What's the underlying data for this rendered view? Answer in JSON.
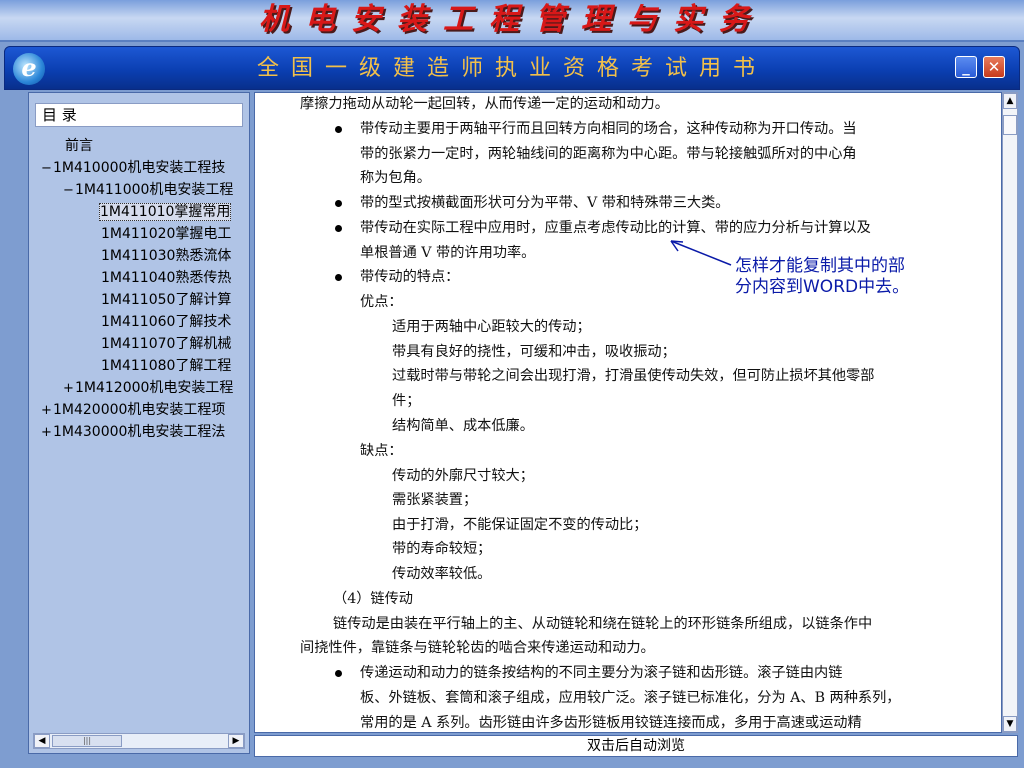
{
  "banner": {
    "title": "机电安装工程管理与实务"
  },
  "titlebar": {
    "subtitle": "全国一级建造师执业资格考试用书",
    "min_glyph": "_",
    "close_glyph": "✕"
  },
  "toc": {
    "header": "目 录",
    "items": [
      {
        "toggle": "",
        "label": "前言"
      },
      {
        "toggle": "−",
        "label": "1M410000机电安装工程技"
      },
      {
        "toggle": "−",
        "label": "1M411000机电安装工程"
      },
      {
        "toggle": "",
        "label": "1M411010掌握常用"
      },
      {
        "toggle": "",
        "label": "1M411020掌握电工"
      },
      {
        "toggle": "",
        "label": "1M411030熟悉流体"
      },
      {
        "toggle": "",
        "label": "1M411040熟悉传热"
      },
      {
        "toggle": "",
        "label": "1M411050了解计算"
      },
      {
        "toggle": "",
        "label": "1M411060了解技术"
      },
      {
        "toggle": "",
        "label": "1M411070了解机械"
      },
      {
        "toggle": "",
        "label": "1M411080了解工程"
      },
      {
        "toggle": "+",
        "label": "1M412000机电安装工程"
      },
      {
        "toggle": "+",
        "label": "1M420000机电安装工程项"
      },
      {
        "toggle": "+",
        "label": "1M430000机电安装工程法"
      }
    ]
  },
  "content": {
    "lines": [
      "摩擦力拖动从动轮一起回转，从而传递一定的运动和动力。",
      "带传动主要用于两轴平行而且回转方向相同的场合，这种传动称为开口传动。当",
      "带的张紧力一定时，两轮轴线间的距离称为中心距。带与轮接触弧所对的中心角",
      "称为包角。",
      "带的型式按横截面形状可分为平带、V 带和特殊带三大类。",
      "带传动在实际工程中应用时，应重点考虑传动比的计算、带的应力分析与计算以及",
      "单根普通 V 带的许用功率。",
      "带传动的特点：",
      "优点：",
      "适用于两轴中心距较大的传动；",
      "带具有良好的挠性，可缓和冲击，吸收振动；",
      "过载时带与带轮之间会出现打滑，打滑虽使传动失效，但可防止损坏其他零部",
      "件；",
      "结构简单、成本低廉。",
      "缺点：",
      "传动的外廓尺寸较大；",
      "需张紧装置；",
      "由于打滑，不能保证固定不变的传动比；",
      "带的寿命较短；",
      "传动效率较低。",
      "（4）链传动",
      "链传动是由装在平行轴上的主、从动链轮和绕在链轮上的环形链条所组成，以链条作中",
      "间挠性件，靠链条与链轮轮齿的啮合来传递运动和动力。",
      "传递运动和动力的链条按结构的不同主要分为滚子链和齿形链。滚子链由内链",
      "板、外链板、套筒和滚子组成，应用较广泛。滚子链已标准化，分为 A、B 两种系列，",
      "常用的是 A 系列。齿形链由许多齿形链板用铰链连接而成，多用于高速或运动精"
    ],
    "annotation": [
      "怎样才能复制其中的部",
      "分内容到WORD中去。"
    ]
  },
  "statusbar": {
    "text": "双击后自动浏览"
  },
  "scroll": {
    "up": "▲",
    "down": "▼",
    "left": "◀",
    "right": "▶",
    "grip": "|||"
  },
  "colors": {
    "banner_text": "#d81818",
    "titlebar": "#0b3fb2",
    "subtitle": "#f2c04a",
    "annotation": "#0a1aa8"
  }
}
